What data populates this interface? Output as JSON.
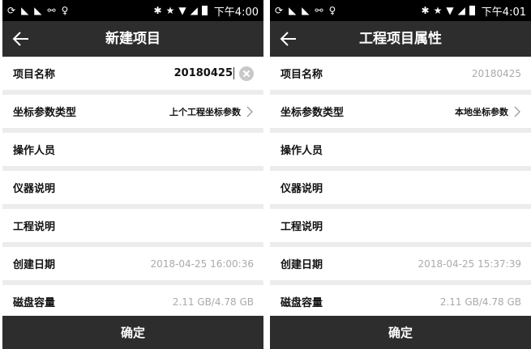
{
  "left": {
    "status": {
      "time": "下午4:00"
    },
    "title": "新建项目",
    "rows": [
      {
        "label": "项目名称",
        "value": "20180425"
      },
      {
        "label": "坐标参数类型",
        "value": "上个工程坐标参数"
      },
      {
        "label": "操作人员",
        "value": ""
      },
      {
        "label": "仪器说明",
        "value": ""
      },
      {
        "label": "工程说明",
        "value": ""
      },
      {
        "label": "创建日期",
        "value": "2018-04-25 16:00:36"
      },
      {
        "label": "磁盘容量",
        "value": "2.11 GB/4.78 GB"
      }
    ],
    "confirm": "确定"
  },
  "right": {
    "status": {
      "time": "下午4:01"
    },
    "title": "工程项目属性",
    "rows": [
      {
        "label": "项目名称",
        "value": "20180425"
      },
      {
        "label": "坐标参数类型",
        "value": "本地坐标参数"
      },
      {
        "label": "操作人员",
        "value": ""
      },
      {
        "label": "仪器说明",
        "value": ""
      },
      {
        "label": "工程说明",
        "value": ""
      },
      {
        "label": "创建日期",
        "value": "2018-04-25 15:37:39"
      },
      {
        "label": "磁盘容量",
        "value": "2.11 GB/4.78 GB"
      }
    ],
    "confirm": "确定"
  },
  "colors": {
    "bar": "#2d2d2d",
    "background": "#ececec",
    "muted": "#aaaaaa"
  },
  "icons": [
    "sync-icon",
    "signal-off-icon",
    "usb-icon",
    "location-icon",
    "bluetooth-icon",
    "star-icon",
    "wifi-icon",
    "cell-signal-icon",
    "battery-icon",
    "back-arrow-icon",
    "clear-icon",
    "chevron-right-icon"
  ]
}
